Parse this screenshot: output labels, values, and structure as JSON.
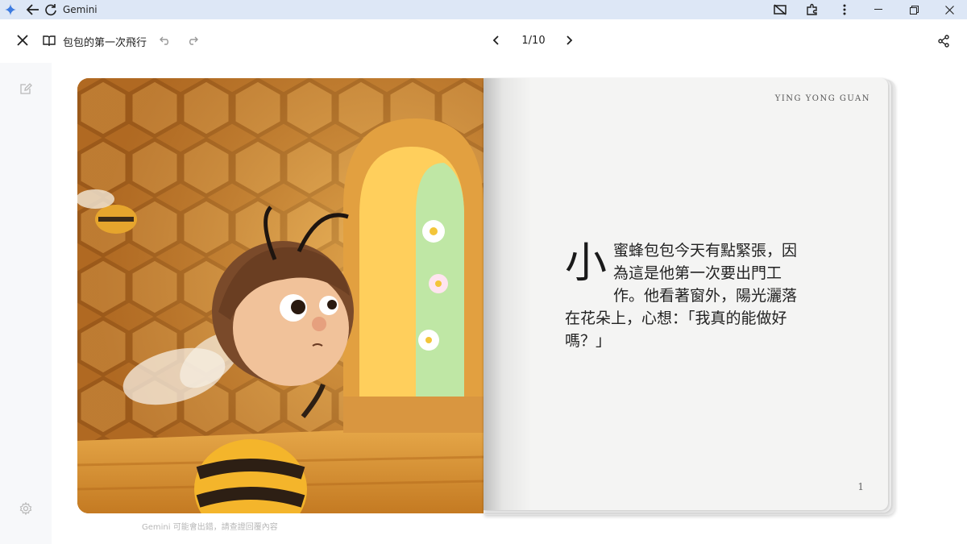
{
  "window": {
    "app_title": "Gemini",
    "title_bar_color": "#dde7f6"
  },
  "toolbar": {
    "book_title": "包包的第一次飛行",
    "page_indicator": "1/10",
    "icons": [
      "close-icon",
      "book-icon",
      "undo-icon",
      "redo-icon",
      "chevron-left-icon",
      "chevron-right-icon",
      "share-icon"
    ]
  },
  "rail": {
    "icons": [
      "edit-icon",
      "settings-icon"
    ]
  },
  "book": {
    "illustration": "bee-at-window",
    "author": "YING YONG GUAN",
    "dropcap": "小",
    "story_text": "蜜蜂包包今天有點緊張，因為這是他第一次要出門工作。他看著窗外，陽光灑落在花朵上，心想：「我真的能做好嗎？」",
    "page_number": "1"
  },
  "footer": {
    "disclaimer": "Gemini 可能會出錯，請查證回覆內容"
  }
}
